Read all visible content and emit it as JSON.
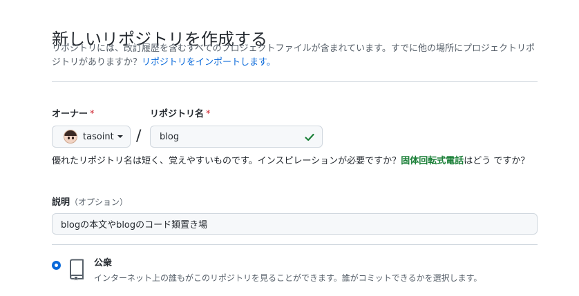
{
  "header": {
    "title": "新しいリポジトリを作成する",
    "description": "リポジトリには、改訂履歴を含むすべてのプロジェクトファイルが含まれています。すでに他の場所にプロジェクトリポジトリがありますか？",
    "import_link": "リポジトリをインポートします。"
  },
  "owner": {
    "label": "オーナー",
    "required_mark": "*",
    "name": "tasoint"
  },
  "repo_name": {
    "label": "リポジトリ名",
    "required_mark": "*",
    "value": "blog",
    "separator": "/",
    "status_icon": "check-icon",
    "hint_prefix": "優れたリポジトリ名は短く、覚えやすいものです。インスピレーションが必要ですか？",
    "hint_suggestion": "固体回転式電話",
    "hint_suffix": "はどう ですか？"
  },
  "description": {
    "label": "説明",
    "optional": "（オプション）",
    "value": "blogの本文やblogのコード類置き場"
  },
  "visibility": {
    "public_title": "公衆",
    "public_desc": "インターネット上の誰もがこのリポジトリを見ることができます。誰がコミットできるかを選択します。",
    "icon": "repo-icon",
    "selected": "public"
  },
  "colors": {
    "accent": "#0969da",
    "success": "#1a7f37",
    "danger": "#cf222e"
  }
}
